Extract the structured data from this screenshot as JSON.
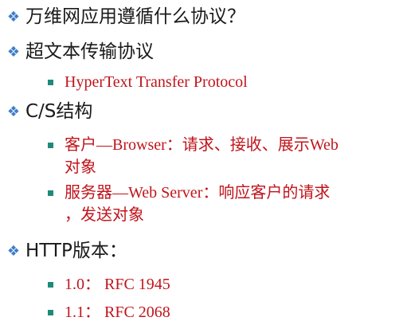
{
  "bullets": {
    "marker": "❖",
    "q1": "万维网应用遵循什么协议？",
    "q2": "超文本传输协议",
    "q2_sub": "HyperText Transfer Protocol",
    "q3": "C/S结构",
    "q3_sub1_line1": "客户—Browser：请求、接收、展示Web",
    "q3_sub1_line2": "对象",
    "q3_sub2_line1": "服务器—Web Server：响应客户的请求",
    "q3_sub2_line2": "，发送对象",
    "q4": "HTTP版本：",
    "q4_sub1": "1.0： RFC 1945",
    "q4_sub2": "1.1： RFC 2068"
  },
  "colors": {
    "marker": "#3f7ec9",
    "sub_bullet": "#1e8a78",
    "sub_text": "#c0141b",
    "main_text": "#1a1a1a"
  }
}
